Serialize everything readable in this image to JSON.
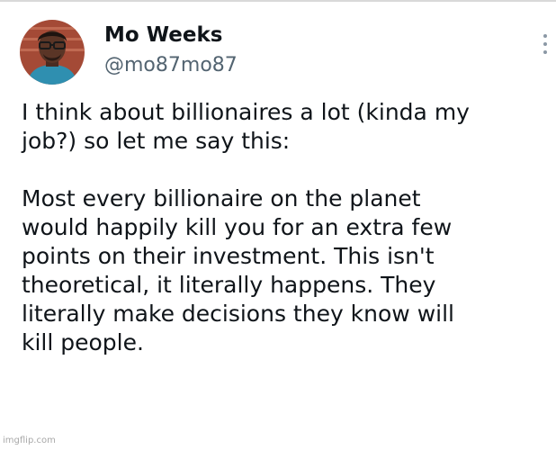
{
  "author": {
    "display_name": "Mo Weeks",
    "handle": "@mo87mo87",
    "avatar_icon": "user-avatar"
  },
  "tweet": {
    "paragraph_1": "I think about billionaires a lot (kinda my\njob?) so let me say this:",
    "paragraph_2": "Most every billionaire on the planet\nwould happily kill you for an extra few\npoints on their investment. This isn't\ntheoretical, it literally happens. They\nliterally make decisions they know will\nkill people."
  },
  "toolbar": {
    "more_icon": "more-vertical-icon"
  },
  "watermark": {
    "text": "imgflip.com"
  },
  "colors": {
    "text_primary": "#0f1419",
    "text_secondary": "#536471",
    "background": "#ffffff"
  }
}
